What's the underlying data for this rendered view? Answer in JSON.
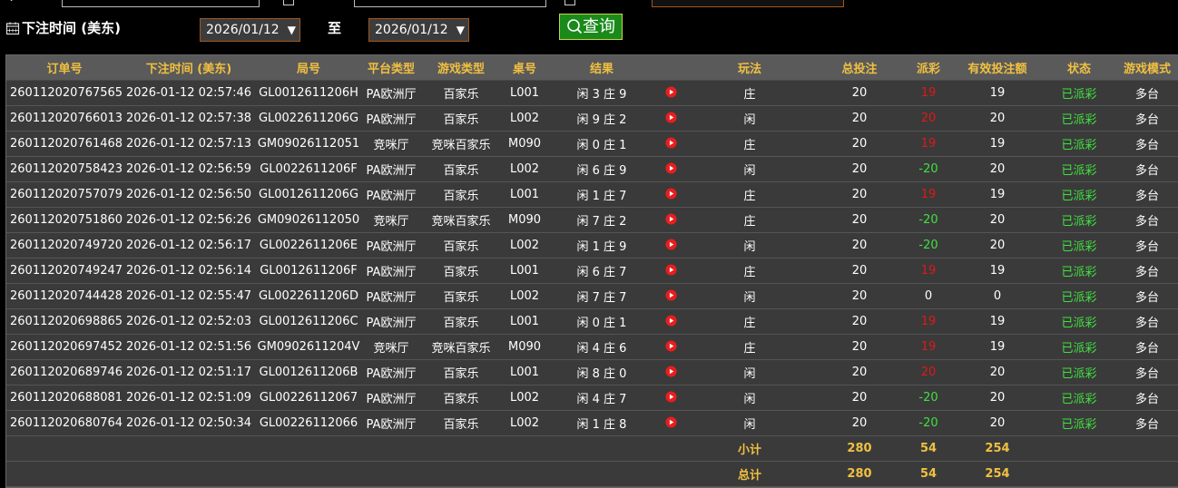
{
  "filter": {
    "label": "下注时间 (美东)",
    "start_date": "2026/01/12",
    "to_label": "至",
    "end_date": "2026/01/12",
    "query_label": "查询"
  },
  "columns": [
    "订单号",
    "下注时间 (美东)",
    "局号",
    "平台类型",
    "游戏类型",
    "桌号",
    "结果",
    "",
    "玩法",
    "总投注",
    "派彩",
    "有效投注额",
    "状态",
    "游戏模式"
  ],
  "rows": [
    [
      "260112020767565",
      "2026-01-12 02:57:46",
      "GL0012611206H",
      "PA欧洲厅",
      "百家乐",
      "L001",
      "闲 3 庄 9",
      "庄",
      "20",
      "19",
      "19",
      "已派彩",
      "多台"
    ],
    [
      "260112020766013",
      "2026-01-12 02:57:38",
      "GL0022611206G",
      "PA欧洲厅",
      "百家乐",
      "L002",
      "闲 9 庄 2",
      "闲",
      "20",
      "20",
      "20",
      "已派彩",
      "多台"
    ],
    [
      "260112020761468",
      "2026-01-12 02:57:13",
      "GM09026112051",
      "竞咪厅",
      "竞咪百家乐",
      "M090",
      "闲 0 庄 1",
      "庄",
      "20",
      "19",
      "19",
      "已派彩",
      "多台"
    ],
    [
      "260112020758423",
      "2026-01-12 02:56:59",
      "GL0022611206F",
      "PA欧洲厅",
      "百家乐",
      "L002",
      "闲 6 庄 9",
      "闲",
      "20",
      "-20",
      "20",
      "已派彩",
      "多台"
    ],
    [
      "260112020757079",
      "2026-01-12 02:56:50",
      "GL0012611206G",
      "PA欧洲厅",
      "百家乐",
      "L001",
      "闲 1 庄 7",
      "庄",
      "20",
      "19",
      "19",
      "已派彩",
      "多台"
    ],
    [
      "260112020751860",
      "2026-01-12 02:56:26",
      "GM09026112050",
      "竞咪厅",
      "竞咪百家乐",
      "M090",
      "闲 7 庄 2",
      "庄",
      "20",
      "-20",
      "20",
      "已派彩",
      "多台"
    ],
    [
      "260112020749720",
      "2026-01-12 02:56:17",
      "GL0022611206E",
      "PA欧洲厅",
      "百家乐",
      "L002",
      "闲 1 庄 9",
      "闲",
      "20",
      "-20",
      "20",
      "已派彩",
      "多台"
    ],
    [
      "260112020749247",
      "2026-01-12 02:56:14",
      "GL0012611206F",
      "PA欧洲厅",
      "百家乐",
      "L001",
      "闲 6 庄 7",
      "庄",
      "20",
      "19",
      "19",
      "已派彩",
      "多台"
    ],
    [
      "260112020744428",
      "2026-01-12 02:55:47",
      "GL0022611206D",
      "PA欧洲厅",
      "百家乐",
      "L002",
      "闲 7 庄 7",
      "闲",
      "20",
      "0",
      "0",
      "已派彩",
      "多台"
    ],
    [
      "260112020698865",
      "2026-01-12 02:52:03",
      "GL0012611206C",
      "PA欧洲厅",
      "百家乐",
      "L001",
      "闲 0 庄 1",
      "庄",
      "20",
      "19",
      "19",
      "已派彩",
      "多台"
    ],
    [
      "260112020697452",
      "2026-01-12 02:51:56",
      "GM0902611204V",
      "竞咪厅",
      "竞咪百家乐",
      "M090",
      "闲 4 庄 6",
      "庄",
      "20",
      "19",
      "19",
      "已派彩",
      "多台"
    ],
    [
      "260112020689746",
      "2026-01-12 02:51:17",
      "GL0012611206B",
      "PA欧洲厅",
      "百家乐",
      "L001",
      "闲 8 庄 0",
      "闲",
      "20",
      "20",
      "20",
      "已派彩",
      "多台"
    ],
    [
      "260112020688081",
      "2026-01-12 02:51:09",
      "GL00226112067",
      "PA欧洲厅",
      "百家乐",
      "L002",
      "闲 4 庄 7",
      "闲",
      "20",
      "-20",
      "20",
      "已派彩",
      "多台"
    ],
    [
      "260112020680764",
      "2026-01-12 02:50:34",
      "GL00226112066",
      "PA欧洲厅",
      "百家乐",
      "L002",
      "闲 1 庄 8",
      "闲",
      "20",
      "-20",
      "20",
      "已派彩",
      "多台"
    ]
  ],
  "payout_colors": {
    "positive": "#e01818",
    "negative": "#40e040",
    "zero": "#ffffff"
  },
  "status_color": "#40e040",
  "summary": [
    {
      "label": "小计",
      "total_bet": "280",
      "payout": "54",
      "valid_bet": "254"
    },
    {
      "label": "总计",
      "total_bet": "280",
      "payout": "54",
      "valid_bet": "254"
    }
  ],
  "icons": {
    "calendar": "calendar-icon",
    "search": "search-icon",
    "replay": "video-play-icon"
  }
}
